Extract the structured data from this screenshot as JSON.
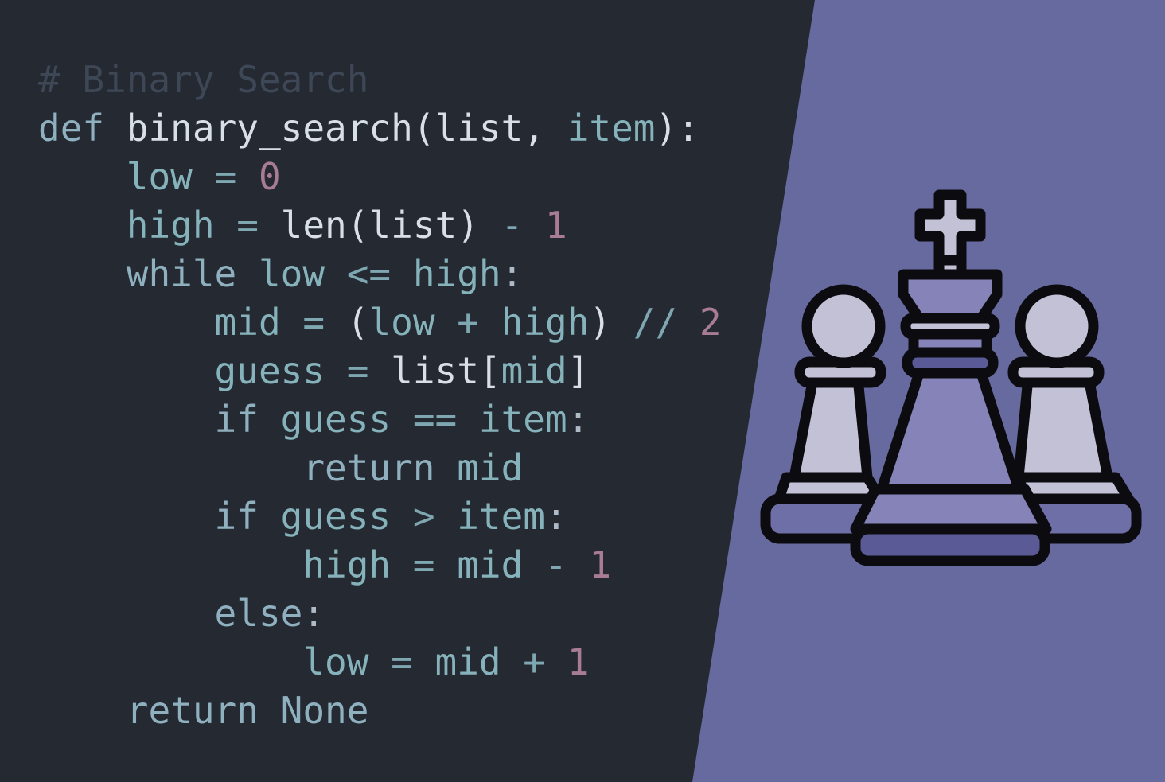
{
  "colors": {
    "background_dark": "#252932",
    "background_purple": "#676a9e",
    "comment": "#3e4756",
    "keyword": "#8fb0bf",
    "function_name": "#d9dfe8",
    "variable": "#86b3bb",
    "number": "#a87c93",
    "piece_light": "#c3c1d6",
    "piece_mid": "#8583b8",
    "piece_shadow": "#5a5a96",
    "outline": "#0c0c10"
  },
  "code": {
    "lines": [
      [
        {
          "t": "# Binary Search",
          "c": "comment"
        }
      ],
      [
        {
          "t": "def",
          "c": "keyword"
        },
        {
          "t": " binary_search(list, ",
          "c": "name"
        },
        {
          "t": "item",
          "c": "var"
        },
        {
          "t": "):",
          "c": "name"
        }
      ],
      [
        {
          "t": "    low",
          "c": "var"
        },
        {
          "t": " = ",
          "c": "op"
        },
        {
          "t": "0",
          "c": "num"
        }
      ],
      [
        {
          "t": "    high",
          "c": "var"
        },
        {
          "t": " = ",
          "c": "op"
        },
        {
          "t": "len(list)",
          "c": "name"
        },
        {
          "t": " - ",
          "c": "op"
        },
        {
          "t": "1",
          "c": "num"
        }
      ],
      [
        {
          "t": "    while",
          "c": "keyword"
        },
        {
          "t": " low ",
          "c": "var"
        },
        {
          "t": "<=",
          "c": "op"
        },
        {
          "t": " high",
          "c": "var"
        },
        {
          "t": ":",
          "c": "punct"
        }
      ],
      [
        {
          "t": "        mid",
          "c": "var"
        },
        {
          "t": " = ",
          "c": "op"
        },
        {
          "t": "(",
          "c": "name"
        },
        {
          "t": "low",
          "c": "var"
        },
        {
          "t": " + ",
          "c": "op"
        },
        {
          "t": "high",
          "c": "var"
        },
        {
          "t": ")",
          "c": "name"
        },
        {
          "t": " // ",
          "c": "op"
        },
        {
          "t": "2",
          "c": "num"
        }
      ],
      [
        {
          "t": "        guess",
          "c": "var"
        },
        {
          "t": " = ",
          "c": "op"
        },
        {
          "t": "list[",
          "c": "name"
        },
        {
          "t": "mid",
          "c": "var"
        },
        {
          "t": "]",
          "c": "name"
        }
      ],
      [
        {
          "t": "        if",
          "c": "keyword"
        },
        {
          "t": " guess ",
          "c": "var"
        },
        {
          "t": "==",
          "c": "op"
        },
        {
          "t": " item",
          "c": "var"
        },
        {
          "t": ":",
          "c": "punct"
        }
      ],
      [
        {
          "t": "            return",
          "c": "keyword"
        },
        {
          "t": " mid",
          "c": "var"
        }
      ],
      [
        {
          "t": "        if",
          "c": "keyword"
        },
        {
          "t": " guess ",
          "c": "var"
        },
        {
          "t": ">",
          "c": "op"
        },
        {
          "t": " item",
          "c": "var"
        },
        {
          "t": ":",
          "c": "punct"
        }
      ],
      [
        {
          "t": "            high",
          "c": "var"
        },
        {
          "t": " = ",
          "c": "op"
        },
        {
          "t": "mid",
          "c": "var"
        },
        {
          "t": " - ",
          "c": "op"
        },
        {
          "t": "1",
          "c": "num"
        }
      ],
      [
        {
          "t": "        else",
          "c": "keyword"
        },
        {
          "t": ":",
          "c": "punct"
        }
      ],
      [
        {
          "t": "            low",
          "c": "var"
        },
        {
          "t": " = ",
          "c": "op"
        },
        {
          "t": "mid",
          "c": "var"
        },
        {
          "t": " + ",
          "c": "op"
        },
        {
          "t": "1",
          "c": "num"
        }
      ],
      [
        {
          "t": "    return",
          "c": "keyword"
        },
        {
          "t": " None",
          "c": "const"
        }
      ]
    ]
  },
  "illustration": {
    "icon": "chess-king-and-pawns-icon"
  }
}
